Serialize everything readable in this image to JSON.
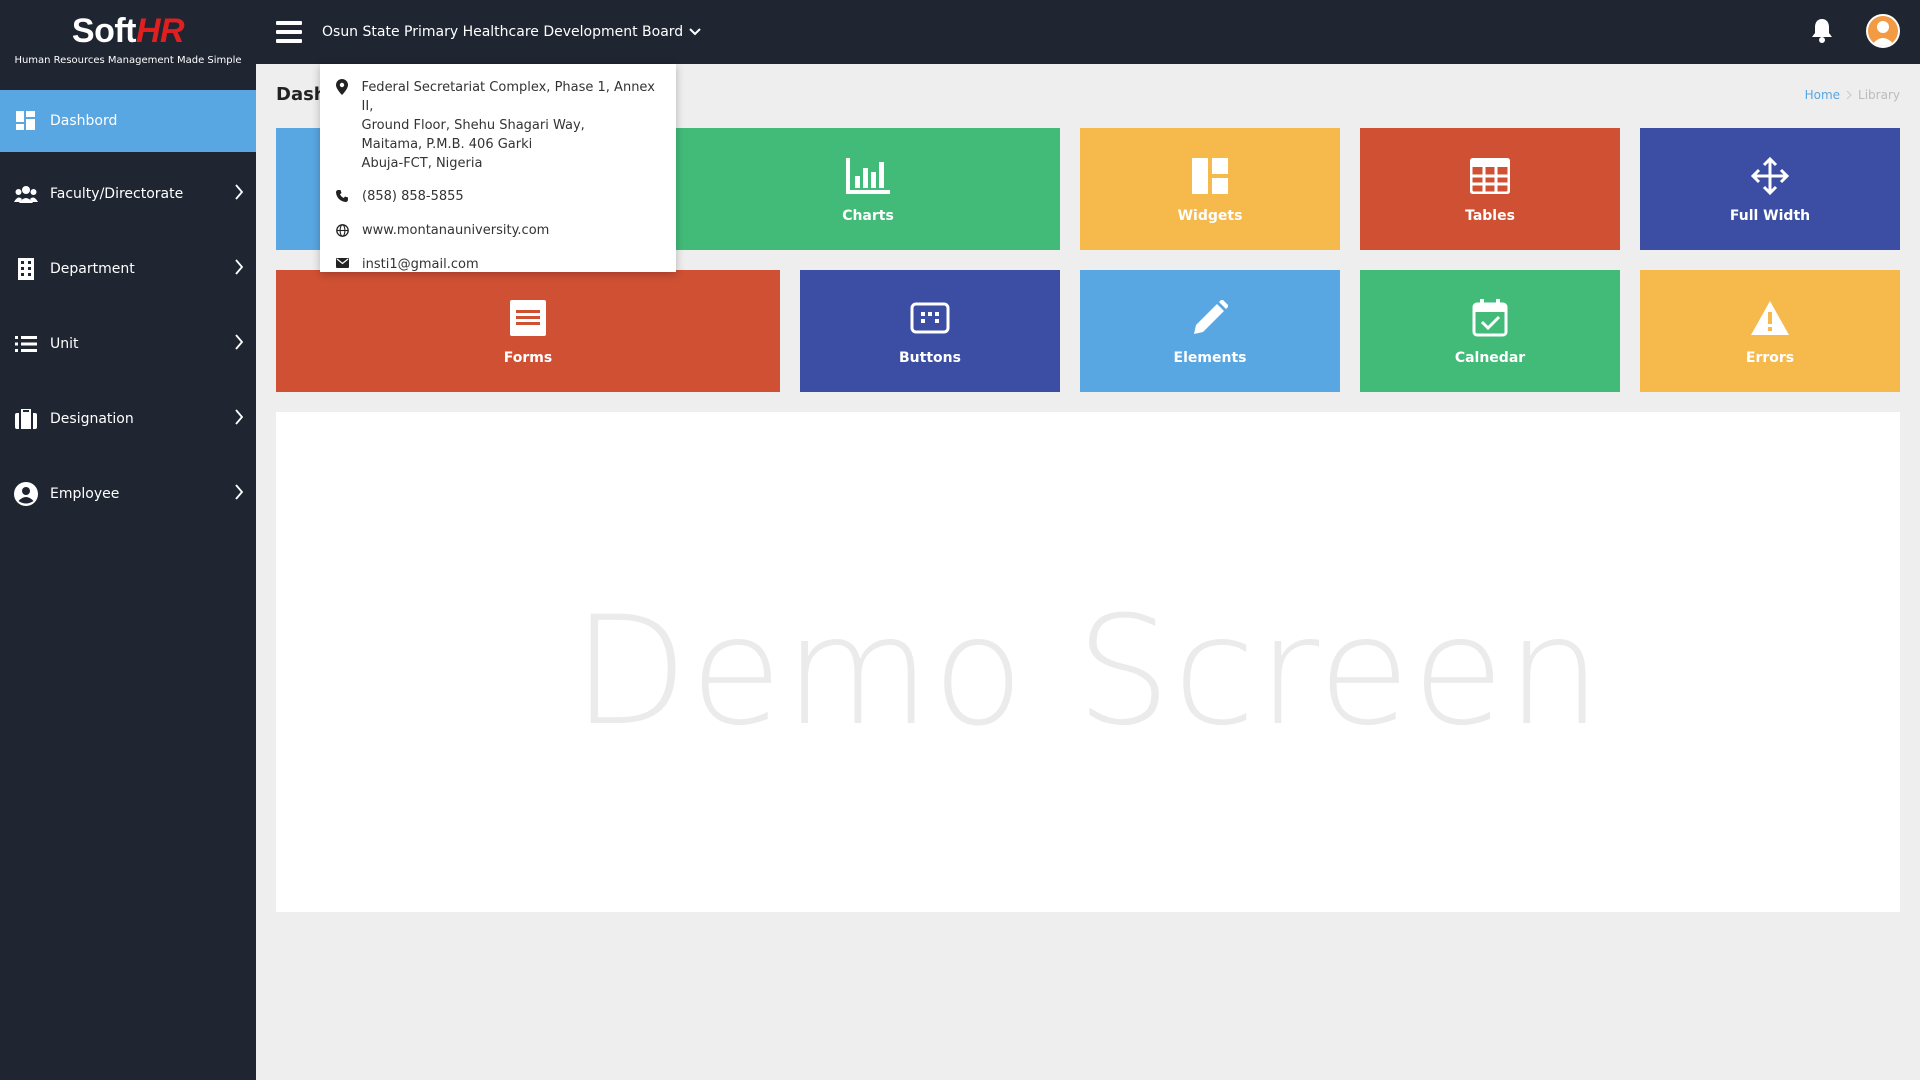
{
  "logo": {
    "soft": "Soft",
    "hr": "HR",
    "tagline": "Human Resources Management Made Simple"
  },
  "sidebar": {
    "items": [
      {
        "label": "Dashbord",
        "icon": "dashboard-icon",
        "active": true
      },
      {
        "label": "Faculty/Directorate",
        "icon": "people-icon"
      },
      {
        "label": "Department",
        "icon": "building-icon"
      },
      {
        "label": "Unit",
        "icon": "list-icon"
      },
      {
        "label": "Designation",
        "icon": "briefcase-icon"
      },
      {
        "label": "Employee",
        "icon": "account-icon"
      }
    ]
  },
  "topbar": {
    "org": "Osun State Primary Healthcare Development Board"
  },
  "dropdown": {
    "address": [
      "Federal Secretariat Complex, Phase 1, Annex II,",
      "Ground Floor, Shehu Shagari Way,",
      "Maitama, P.M.B. 406 Garki",
      "Abuja-FCT, Nigeria"
    ],
    "phone": "(858) 858-5855",
    "website": "www.montanauniversity.com",
    "email": "insti1@gmail.com"
  },
  "page": {
    "title": "Dash"
  },
  "breadcrumb": {
    "home": "Home",
    "current": "Library"
  },
  "tiles": [
    {
      "label": "Charts",
      "color": "#42bb79"
    },
    {
      "label": "Widgets",
      "color": "#f6b94c"
    },
    {
      "label": "Tables",
      "color": "#d05034"
    },
    {
      "label": "Full Width",
      "color": "#3b4ea3"
    },
    {
      "label": "Forms",
      "color": "#d05034"
    },
    {
      "label": "Buttons",
      "color": "#3b4ea3"
    },
    {
      "label": "Elements",
      "color": "#58a6e2"
    },
    {
      "label": "Calnedar",
      "color": "#42bb79"
    },
    {
      "label": "Errors",
      "color": "#f6b94c"
    }
  ],
  "demo": {
    "text": "Demo Screen"
  },
  "colors": {
    "sidebar_bg": "#1f2531",
    "active": "#58a6e2",
    "page_bg": "#eeeeee"
  }
}
